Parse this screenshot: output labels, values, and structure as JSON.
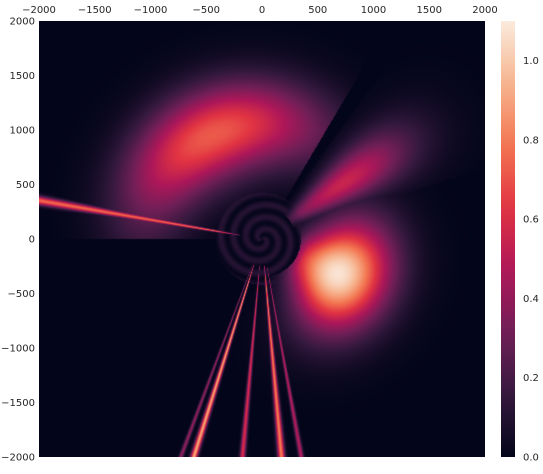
{
  "chart_data": {
    "type": "heatmap",
    "title": "",
    "xlabel": "",
    "ylabel": "",
    "x_axis_position": "top",
    "xlim": [
      -2000,
      2000
    ],
    "ylim": [
      -2000,
      2000
    ],
    "xticks": [
      -2000,
      -1500,
      -1000,
      -500,
      0,
      500,
      1000,
      1500,
      2000
    ],
    "yticks": [
      2000,
      1500,
      1000,
      500,
      0,
      -500,
      -1000,
      -1500,
      -2000
    ],
    "grid": false,
    "colormap": "rocket",
    "colormap_stops": [
      "#03051a",
      "#35193e",
      "#701f57",
      "#ae1759",
      "#e13342",
      "#f37651",
      "#f6b48f",
      "#faebdd"
    ],
    "colorbar": {
      "position": "right",
      "range": [
        0.0,
        1.1
      ],
      "ticks": [
        0.0,
        0.2,
        0.4,
        0.6,
        0.8,
        1.0
      ]
    }
  }
}
